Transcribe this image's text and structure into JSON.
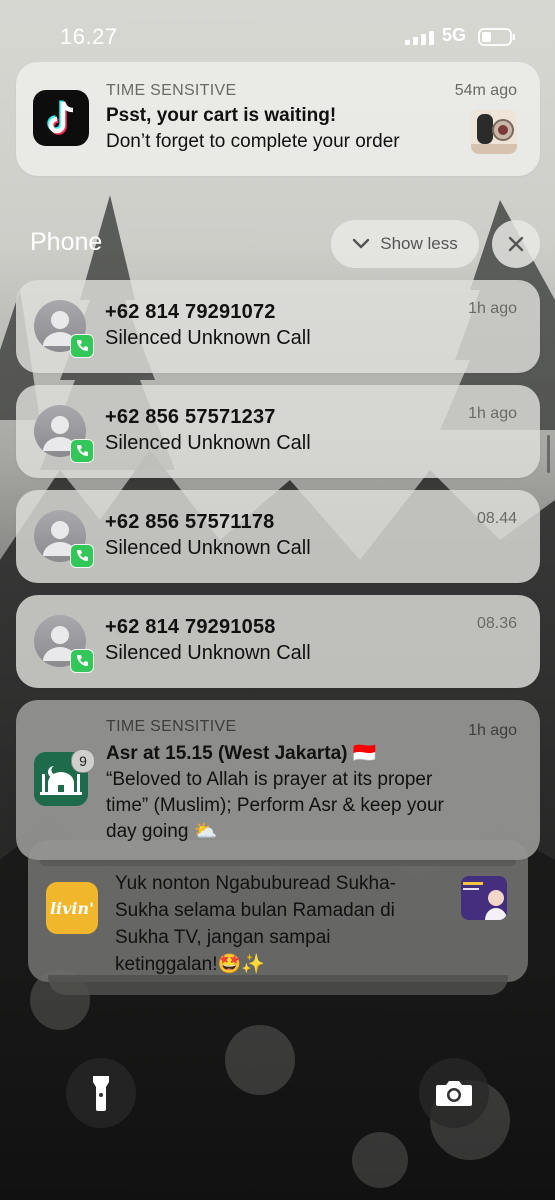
{
  "status_bar": {
    "time": "16.27",
    "network": "5G"
  },
  "tiktok_notification": {
    "label": "TIME SENSITIVE",
    "time": "54m ago",
    "title": "Psst, your cart is waiting!",
    "body": "Don’t forget to complete your order",
    "app_icon": "tiktok-icon"
  },
  "phone_group": {
    "title": "Phone",
    "show_less_label": "Show less",
    "calls": [
      {
        "number": "+62 814 79291072",
        "subtitle": "Silenced Unknown Call",
        "time": "1h ago"
      },
      {
        "number": "+62 856 57571237",
        "subtitle": "Silenced Unknown Call",
        "time": "1h ago"
      },
      {
        "number": "+62 856 57571178",
        "subtitle": "Silenced Unknown Call",
        "time": "08.44"
      },
      {
        "number": "+62 814 79291058",
        "subtitle": "Silenced Unknown Call",
        "time": "08.36"
      }
    ]
  },
  "prayer_notification": {
    "label": "TIME SENSITIVE",
    "time": "1h ago",
    "title": "Asr at 15.15 (West Jakarta) 🇮🇩",
    "body_line1": "“Beloved to Allah is prayer at its proper",
    "body_line2": "time” (Muslim); Perform Asr & keep your",
    "body_line3": "day going ⛅",
    "badge_count": "9",
    "app_icon": "mosque-icon"
  },
  "stacked_notification": {
    "app_icon_text": "livin'",
    "body_line1": "Yuk nonton Ngabuburead Sukha-",
    "body_line2": "Sukha selama bulan Ramadan di",
    "body_line3": "Sukha TV, jangan sampai",
    "body_line4": "ketinggalan!🤩✨"
  },
  "colors": {
    "call_badge": "#33c759",
    "prayer_icon_bg": "#1d6b4a",
    "livin_bg": "#f0b72c"
  }
}
